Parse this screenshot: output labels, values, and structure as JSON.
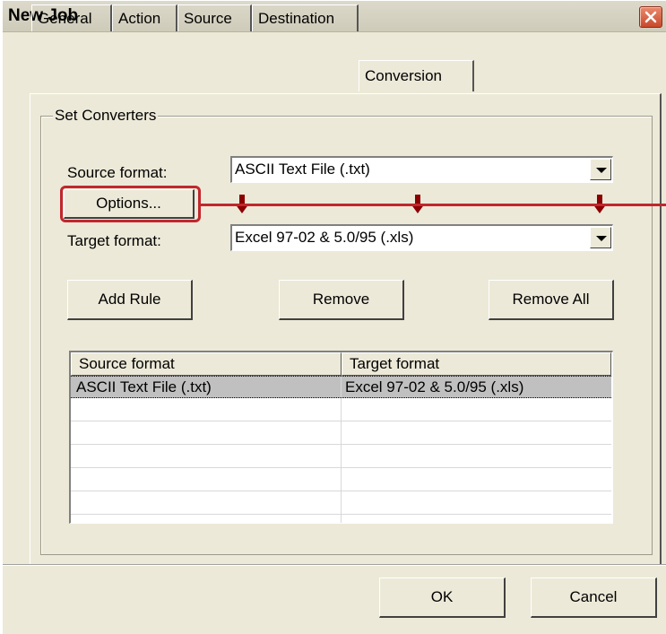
{
  "window": {
    "title": "New Job"
  },
  "tabs": [
    {
      "label": "General"
    },
    {
      "label": "Action"
    },
    {
      "label": "Source"
    },
    {
      "label": "Destination"
    },
    {
      "label": "Conversion",
      "active": true
    }
  ],
  "group": {
    "legend": "Set Converters",
    "source_format_label": "Source format:",
    "source_format_value": "ASCII Text File (.txt)",
    "options_button": "Options...",
    "target_format_label": "Target format:",
    "target_format_value": "Excel 97-02 & 5.0/95 (.xls)",
    "add_rule_button": "Add Rule",
    "remove_button": "Remove",
    "remove_all_button": "Remove All"
  },
  "rules_table": {
    "columns": [
      "Source format",
      "Target format"
    ],
    "rows": [
      {
        "source": "ASCII Text File (.txt)",
        "target": "Excel 97-02 & 5.0/95 (.xls)",
        "selected": true
      }
    ]
  },
  "footer": {
    "ok_button": "OK",
    "cancel_button": "Cancel"
  },
  "colors": {
    "dialog_bg": "#ece9d8",
    "highlight_red": "#c1272d",
    "arrow_red": "#8b0000",
    "selected_row": "#c0c0c0"
  }
}
